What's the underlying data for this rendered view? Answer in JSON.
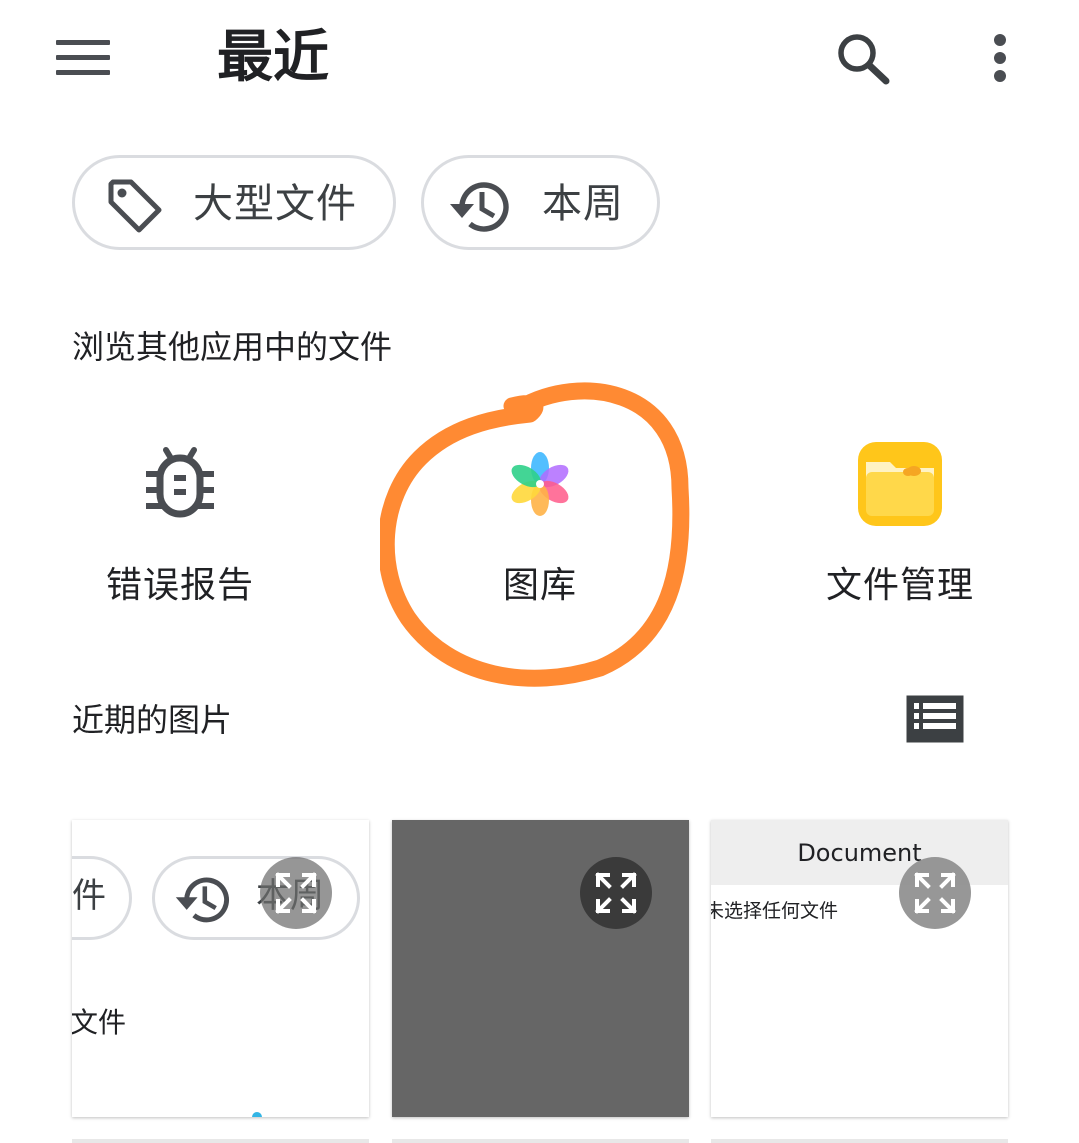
{
  "app_bar": {
    "title": "最近",
    "menu_icon": "menu-icon",
    "search_icon": "search-icon",
    "more_icon": "more-vert-icon"
  },
  "chips": [
    {
      "label": "大型文件",
      "icon": "tag-icon"
    },
    {
      "label": "本周",
      "icon": "history-icon"
    }
  ],
  "browse_section": {
    "title": "浏览其他应用中的文件",
    "apps": [
      {
        "label": "错误报告",
        "icon": "bug-icon"
      },
      {
        "label": "图库",
        "icon": "gallery-flower-icon"
      },
      {
        "label": "文件管理",
        "icon": "file-manager-folder-icon"
      }
    ]
  },
  "recent_images": {
    "title": "近期的图片",
    "view_toggle_icon": "list-view-icon",
    "thumbnails": [
      {
        "chip_a_label": "件",
        "chip_b_label": "本周",
        "section_text": "的文件"
      },
      {},
      {
        "header_title": "Document",
        "body_text": "未选择任何文件"
      }
    ]
  },
  "colors": {
    "annotation_circle": "#FF8A33",
    "chip_border": "#dadce0",
    "icon_gray": "#4a4d52",
    "folder_yellow": "#FFC61A"
  }
}
